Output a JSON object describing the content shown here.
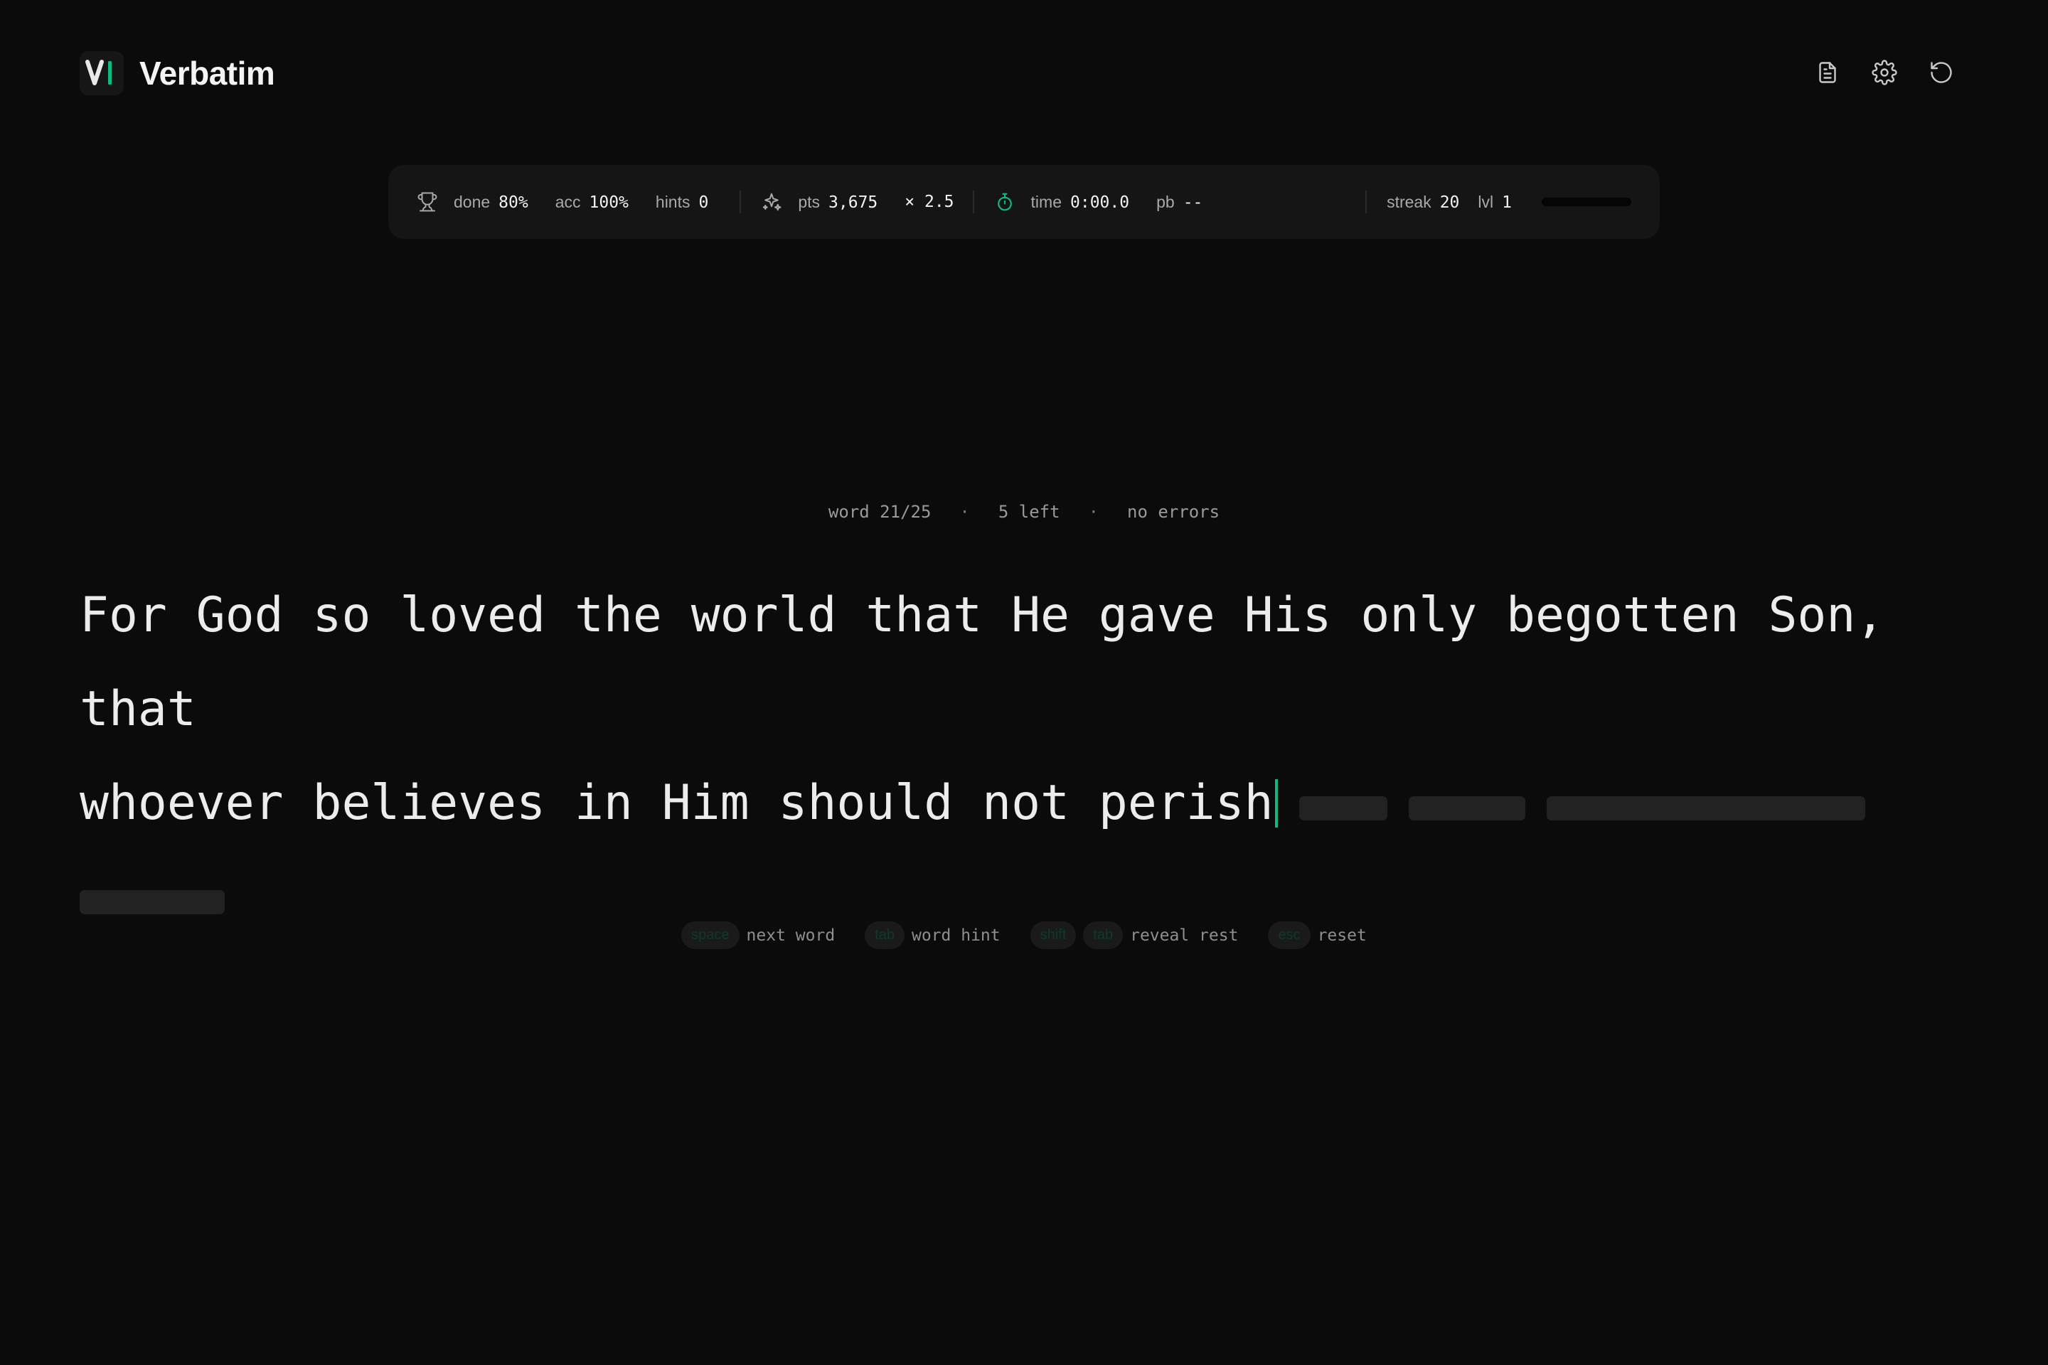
{
  "app": {
    "title": "Verbatim",
    "accent_color": "#10b981",
    "background_color": "#0b0b0b"
  },
  "header": {
    "actions": [
      {
        "name": "document-icon",
        "label": "document"
      },
      {
        "name": "gear-icon",
        "label": "settings"
      },
      {
        "name": "reset-icon",
        "label": "reset"
      }
    ]
  },
  "stats": {
    "done_label": "done",
    "done_value": "80%",
    "acc_label": "acc",
    "acc_value": "100%",
    "hints_label": "hints",
    "hints_value": "0",
    "pts_label": "pts",
    "pts_value": "3,675",
    "multiplier": "× 2.5",
    "time_label": "time",
    "time_value": "0:00.0",
    "pb_label": "pb",
    "pb_value": "--",
    "streak_label": "streak",
    "streak_value": "20",
    "lvl_label": "lvl",
    "lvl_value": "1",
    "level_progress": 0.0
  },
  "progress": {
    "word": "word 21/25",
    "left": "5 left",
    "errors": "no errors",
    "separator": "·"
  },
  "passage": {
    "line1": "For God so loved the world that He gave His only begotten Son, that",
    "line2": "whoever believes in Him should not perish",
    "hidden_words_count": 4
  },
  "shortcuts": [
    {
      "keys": [
        "space"
      ],
      "label": "next word"
    },
    {
      "keys": [
        "tab"
      ],
      "label": "word hint"
    },
    {
      "keys": [
        "shift",
        "tab"
      ],
      "label": "reveal rest"
    },
    {
      "keys": [
        "esc"
      ],
      "label": "reset"
    }
  ]
}
